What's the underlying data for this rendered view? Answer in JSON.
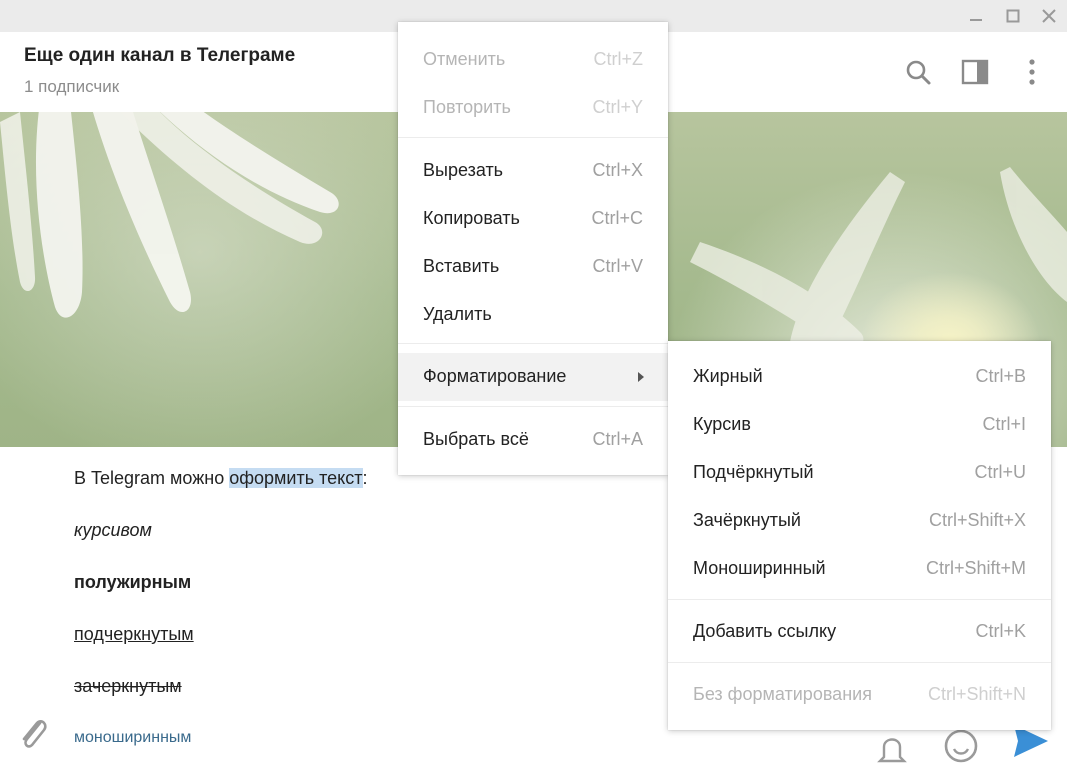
{
  "header": {
    "title": "Еще один канал в Телеграме",
    "subtitle": "1 подписчик"
  },
  "composer": {
    "lines": {
      "intro_before": "В Telegram можно ",
      "intro_selected": "оформить текст",
      "intro_after": ":",
      "italic": "курсивом",
      "bold": "полужирным",
      "underline": "подчеркнутым",
      "strike": "зачеркнутым",
      "mono": "моноширинным"
    }
  },
  "context_menu": {
    "undo": {
      "label": "Отменить",
      "shortcut": "Ctrl+Z"
    },
    "redo": {
      "label": "Повторить",
      "shortcut": "Ctrl+Y"
    },
    "cut": {
      "label": "Вырезать",
      "shortcut": "Ctrl+X"
    },
    "copy": {
      "label": "Копировать",
      "shortcut": "Ctrl+C"
    },
    "paste": {
      "label": "Вставить",
      "shortcut": "Ctrl+V"
    },
    "delete": {
      "label": "Удалить"
    },
    "formatting": {
      "label": "Форматирование"
    },
    "select_all": {
      "label": "Выбрать всё",
      "shortcut": "Ctrl+A"
    }
  },
  "format_submenu": {
    "bold": {
      "label": "Жирный",
      "shortcut": "Ctrl+B"
    },
    "italic": {
      "label": "Курсив",
      "shortcut": "Ctrl+I"
    },
    "underline": {
      "label": "Подчёркнутый",
      "shortcut": "Ctrl+U"
    },
    "strike": {
      "label": "Зачёркнутый",
      "shortcut": "Ctrl+Shift+X"
    },
    "mono": {
      "label": "Моноширинный",
      "shortcut": "Ctrl+Shift+M"
    },
    "link": {
      "label": "Добавить ссылку",
      "shortcut": "Ctrl+K"
    },
    "clear": {
      "label": "Без форматирования",
      "shortcut": "Ctrl+Shift+N"
    }
  },
  "colors": {
    "accent": "#3a8fd6",
    "selection": "#c5dcf2",
    "icon": "#7f7f7f"
  }
}
